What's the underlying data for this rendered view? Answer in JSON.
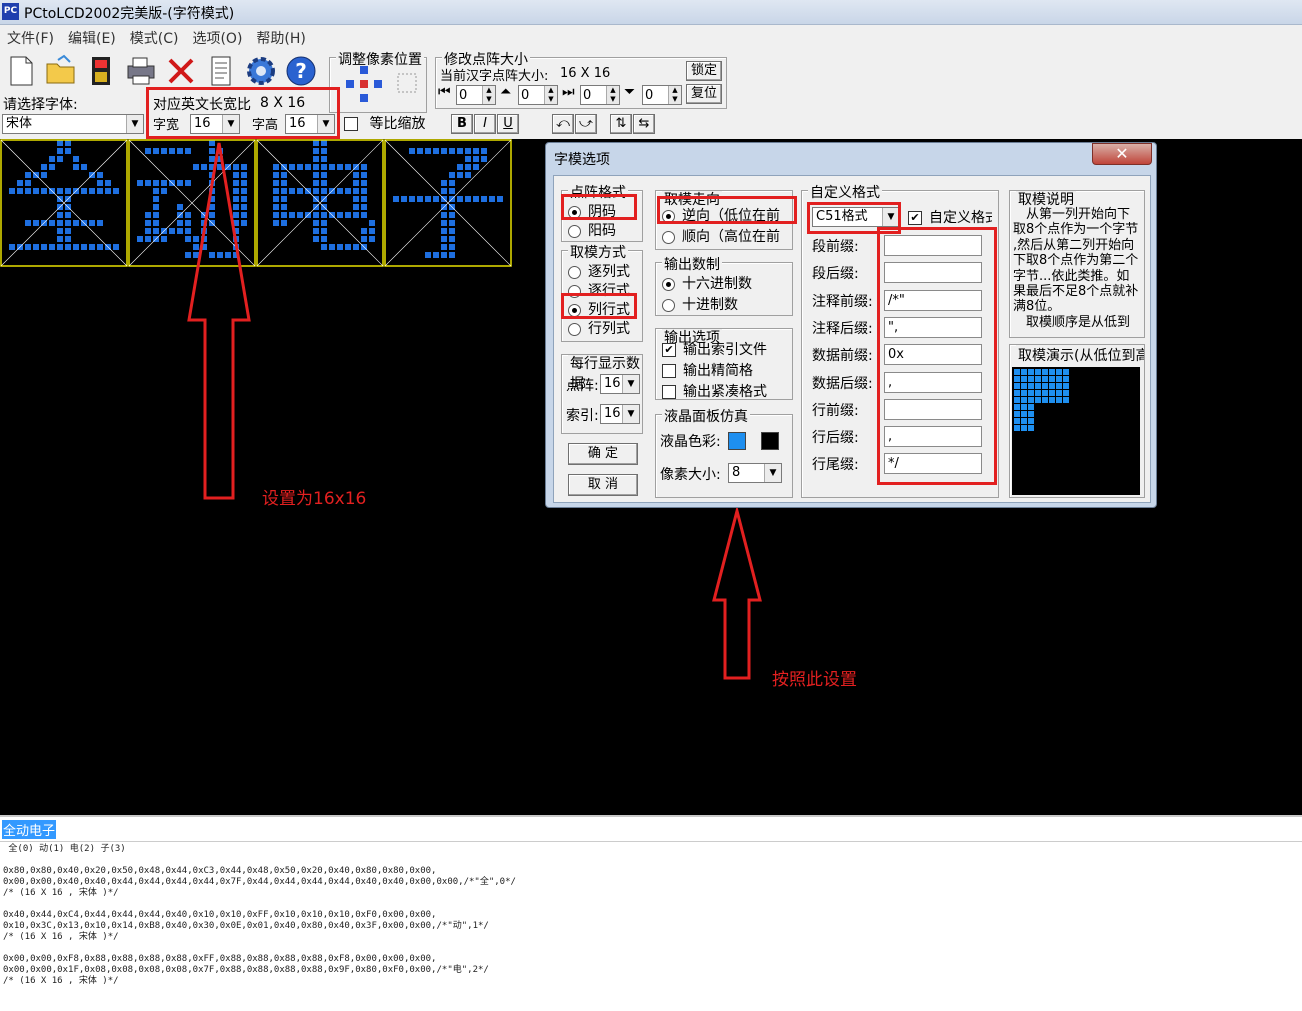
{
  "window": {
    "title": "PCtoLCD2002完美版-(字符模式)",
    "app_icon": "PC"
  },
  "menu": [
    "文件(F)",
    "编辑(E)",
    "模式(C)",
    "选项(O)",
    "帮助(H)"
  ],
  "toolbar": {
    "icons": [
      "new-file-icon",
      "open-folder-icon",
      "save-disk-icon",
      "printer-icon",
      "delete-x-icon",
      "document-icon",
      "gear-icon",
      "help-icon"
    ],
    "pixel_pos_group": "调整像素位置",
    "matrix_group": "修改点阵大小",
    "hanzi_size_label": "当前汉字点阵大小:",
    "hanzi_size_value": "16 X 16",
    "lock_button": "锁定",
    "reset_button": "复位",
    "offsets": [
      "0",
      "0",
      "0",
      "0"
    ]
  },
  "font": {
    "label": "请选择字体:",
    "value": "宋体",
    "ratio_label": "对应英文长宽比",
    "ratio_value": "8 X 16",
    "width_label": "字宽",
    "width_value": "16",
    "height_label": "字高",
    "height_value": "16",
    "proportional": "等比缩放",
    "bold": "B",
    "italic": "I",
    "underline": "U"
  },
  "canvas": {
    "glyphs": [
      "全",
      "动",
      "电",
      "子"
    ],
    "pixel_color": "#1e6fe0",
    "border_color": "#e8e000"
  },
  "dialog": {
    "title": "字模选项",
    "close": "✕",
    "dot_format": {
      "legend": "点阵格式",
      "options": [
        "阴码",
        "阳码"
      ],
      "selected": "阴码"
    },
    "scan_mode": {
      "legend": "取模方式",
      "options": [
        "逐列式",
        "逐行式",
        "列行式",
        "行列式"
      ],
      "selected": "列行式"
    },
    "per_row": {
      "legend": "每行显示数据",
      "dot_label": "点阵:",
      "dot_value": "16",
      "index_label": "索引:",
      "index_value": "16"
    },
    "ok": "确 定",
    "cancel": "取 消",
    "direction": {
      "legend": "取模走向",
      "options": [
        "逆向（低位在前",
        "顺向（高位在前"
      ],
      "selected": "逆向（低位在前"
    },
    "number_format": {
      "legend": "输出数制",
      "options": [
        "十六进制数",
        "十进制数"
      ],
      "selected": "十六进制数"
    },
    "output_options": {
      "legend": "输出选项",
      "items": [
        "输出索引文件",
        "输出精简格",
        "输出紧凑格式"
      ],
      "checked": [
        true,
        false,
        false
      ]
    },
    "lcd": {
      "legend": "液晶面板仿真",
      "color_label": "液晶色彩:",
      "color_on": "#1e8ff0",
      "color_off": "#000000",
      "pixel_label": "像素大小:",
      "pixel_value": "8"
    },
    "custom": {
      "legend": "自定义格式",
      "format_value": "C51格式",
      "custom_check": "自定义格式",
      "fields": [
        {
          "label": "段前缀:",
          "value": ""
        },
        {
          "label": "段后缀:",
          "value": ""
        },
        {
          "label": "注释前缀:",
          "value": "/*\""
        },
        {
          "label": "注释后缀:",
          "value": "\","
        },
        {
          "label": "数据前缀:",
          "value": "0x"
        },
        {
          "label": "数据后缀:",
          "value": ","
        },
        {
          "label": "行前缀:",
          "value": ""
        },
        {
          "label": "行后缀:",
          "value": ","
        },
        {
          "label": "行尾缀:",
          "value": "*/"
        }
      ]
    },
    "explain": {
      "legend": "取模说明",
      "lines": [
        "　从第一列开始向下",
        "取8个点作为一个字节",
        ",然后从第二列开始向",
        "下取8个点作为第二个",
        "字节...依此类推。如",
        "果最后不足8个点就补",
        "满8位。",
        "　取模顺序是从低到"
      ]
    },
    "demo": {
      "legend": "取模演示(从低位到高"
    }
  },
  "annotations": {
    "left": "设置为16x16",
    "right": "按照此设置"
  },
  "output": {
    "selected_text": "全动电子",
    "lines": [
      " 全(0) 动(1) 电(2) 子(3)",
      "",
      "0x80,0x80,0x40,0x20,0x50,0x48,0x44,0xC3,0x44,0x48,0x50,0x20,0x40,0x80,0x80,0x00,",
      "0x00,0x00,0x40,0x40,0x44,0x44,0x44,0x44,0x7F,0x44,0x44,0x44,0x44,0x40,0x40,0x00,0x00,/*\"全\",0*/",
      "/* (16 X 16 , 宋体 )*/",
      "",
      "0x40,0x44,0xC4,0x44,0x44,0x44,0x40,0x10,0x10,0xFF,0x10,0x10,0x10,0xF0,0x00,0x00,",
      "0x10,0x3C,0x13,0x10,0x14,0xB8,0x40,0x30,0x0E,0x01,0x40,0x80,0x40,0x3F,0x00,0x00,/*\"动\",1*/",
      "/* (16 X 16 , 宋体 )*/",
      "",
      "0x00,0x00,0xF8,0x88,0x88,0x88,0x88,0xFF,0x88,0x88,0x88,0x88,0xF8,0x00,0x00,0x00,",
      "0x00,0x00,0x1F,0x08,0x08,0x08,0x08,0x7F,0x88,0x88,0x88,0x88,0x9F,0x80,0xF0,0x00,/*\"电\",2*/",
      "/* (16 X 16 , 宋体 )*/"
    ]
  }
}
